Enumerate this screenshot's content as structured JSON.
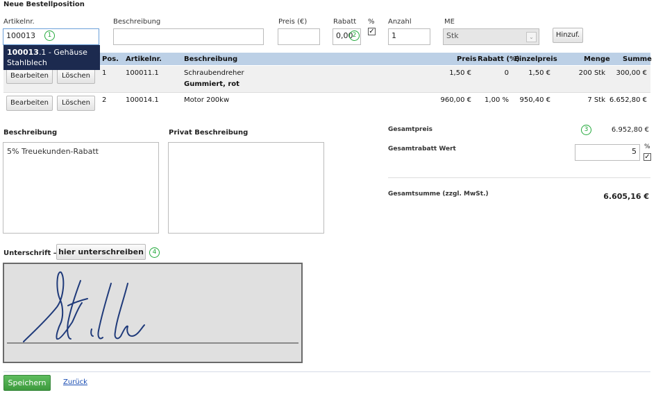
{
  "header": {
    "title": "Neue Bestellposition"
  },
  "form": {
    "artikelnr_label": "Artikelnr.",
    "artikelnr_value": "100013",
    "beschreibung_label": "Beschreibung",
    "beschreibung_value": "",
    "preis_label": "Preis (€)",
    "preis_value": "",
    "rabatt_label": "Rabatt",
    "rabatt_value": "0,00",
    "percent_label": "%",
    "percent_checked": true,
    "anzahl_label": "Anzahl",
    "anzahl_value": "1",
    "me_label": "ME",
    "me_value": "Stk",
    "add_button": "Hinzuf."
  },
  "autocomplete": {
    "match": "100013",
    "rest": ".1 - Gehäuse",
    "line2": "Stahlblech"
  },
  "markers": {
    "m1": "1",
    "m2": "2",
    "m3": "3",
    "m4": "4"
  },
  "table": {
    "headers": {
      "pos": "Pos.",
      "artikelnr": "Artikelnr.",
      "beschreibung": "Beschreibung",
      "preis": "Preis",
      "rabatt": "Rabatt (%)",
      "einzelpreis": "Einzelpreis",
      "menge": "Menge",
      "summe": "Summe"
    },
    "edit_label": "Bearbeiten",
    "delete_label": "Löschen",
    "rows": [
      {
        "pos": "1",
        "artikelnr": "100011.1",
        "beschreibung": "Schraubendreher",
        "beschreibung2": "Gummiert, rot",
        "preis": "1,50 €",
        "rabatt": "0",
        "einzelpreis": "1,50 €",
        "menge": "200 Stk",
        "summe": "300,00 €"
      },
      {
        "pos": "2",
        "artikelnr": "100014.1",
        "beschreibung": "Motor 200kw",
        "beschreibung2": "",
        "preis": "960,00 €",
        "rabatt": "1,00 %",
        "einzelpreis": "950,40 €",
        "menge": "7 Stk",
        "summe": "6.652,80 €"
      }
    ]
  },
  "notes": {
    "beschreibung_label": "Beschreibung",
    "beschreibung_value": "5% Treuekunden-Rabatt",
    "privat_label": "Privat Beschreibung",
    "privat_value": ""
  },
  "totals": {
    "gesamtpreis_label": "Gesamtpreis",
    "gesamtpreis_value": "6.952,80 €",
    "rabatt_label": "Gesamtrabatt Wert",
    "rabatt_value": "5",
    "rabatt_unit": "%",
    "rabatt_percent_checked": true,
    "summe_label": "Gesamtsumme (zzgl. MwSt.)",
    "summe_value": "6.605,16 €"
  },
  "signature": {
    "label": "Unterschrift –",
    "button": "hier unterschreiben",
    "ink_color": "#1f3a7a"
  },
  "footer": {
    "save": "Speichern",
    "back": "Zurück"
  },
  "colors": {
    "table_header": "#bcd0e6",
    "autocomplete_bg": "#1c2a4f",
    "marker": "#22a83a",
    "save_green": "#3d9a3d",
    "link": "#1a4db3"
  }
}
